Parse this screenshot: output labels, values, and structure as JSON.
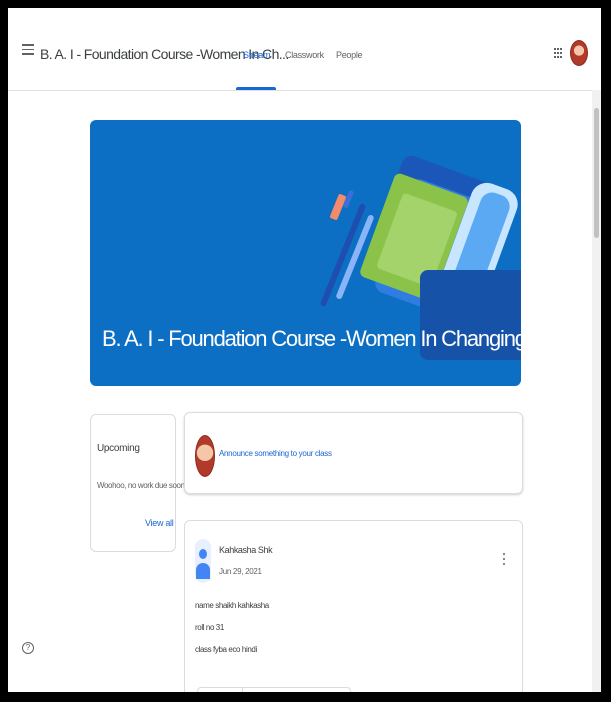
{
  "header": {
    "course_title": "B. A. I - Foundation Course -Women In Ch...",
    "tabs": [
      {
        "label": "Stream",
        "active": true
      },
      {
        "label": "Classwork",
        "active": false
      },
      {
        "label": "People",
        "active": false
      }
    ]
  },
  "banner": {
    "title": "B. A. I - Foundation Course -Women In Changing India..."
  },
  "upcoming": {
    "title": "Upcoming",
    "empty_text": "Woohoo, no work due soon!",
    "view_all_label": "View all"
  },
  "announce": {
    "placeholder": "Announce something to your class"
  },
  "post": {
    "author": "Kahkasha Shk",
    "date": "Jun 29, 2021",
    "lines": [
      "name shaikh kahkasha",
      "roll no 31",
      "class fyba eco hindi"
    ]
  },
  "help": {
    "glyph": "?"
  },
  "colors": {
    "accent": "#1967d2",
    "banner": "#0d6fc4"
  }
}
